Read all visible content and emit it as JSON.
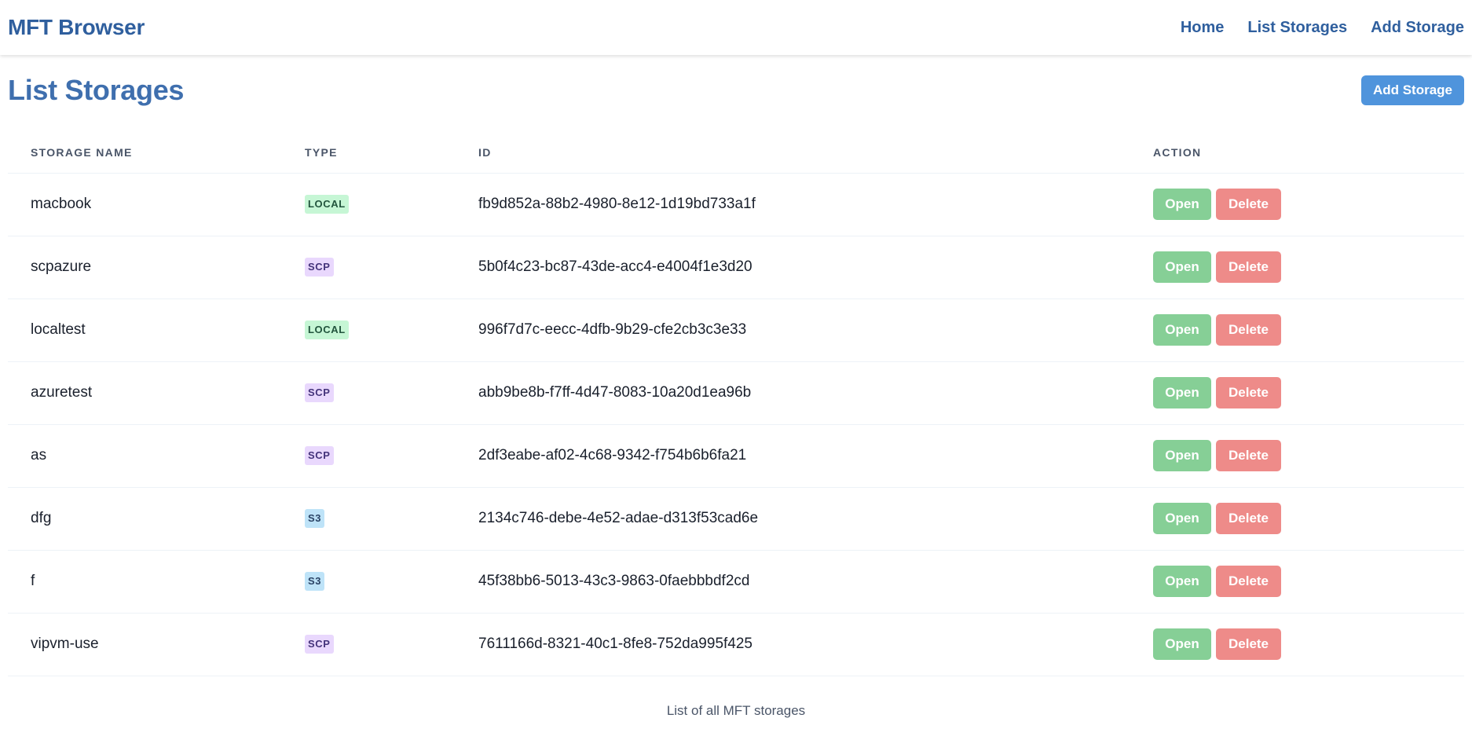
{
  "nav": {
    "brand": "MFT Browser",
    "links": [
      "Home",
      "List Storages",
      "Add Storage"
    ]
  },
  "page": {
    "title": "List Storages",
    "add_button": "Add Storage"
  },
  "table": {
    "headers": [
      "STORAGE NAME",
      "TYPE",
      "ID",
      "ACTION"
    ],
    "open_label": "Open",
    "delete_label": "Delete",
    "rows": [
      {
        "name": "macbook",
        "type": "LOCAL",
        "id": "fb9d852a-88b2-4980-8e12-1d19bd733a1f"
      },
      {
        "name": "scpazure",
        "type": "SCP",
        "id": "5b0f4c23-bc87-43de-acc4-e4004f1e3d20"
      },
      {
        "name": "localtest",
        "type": "LOCAL",
        "id": "996f7d7c-eecc-4dfb-9b29-cfe2cb3c3e33"
      },
      {
        "name": "azuretest",
        "type": "SCP",
        "id": "abb9be8b-f7ff-4d47-8083-10a20d1ea96b"
      },
      {
        "name": "as",
        "type": "SCP",
        "id": "2df3eabe-af02-4c68-9342-f754b6b6fa21"
      },
      {
        "name": "dfg",
        "type": "S3",
        "id": "2134c746-debe-4e52-adae-d313f53cad6e"
      },
      {
        "name": "f",
        "type": "S3",
        "id": "45f38bb6-5013-43c3-9863-0faebbbdf2cd"
      },
      {
        "name": "vipvm-use",
        "type": "SCP",
        "id": "7611166d-8321-40c1-8fe8-752da995f425"
      }
    ],
    "caption": "List of all MFT storages"
  },
  "colors": {
    "brand": "#2f5f9e",
    "primary_button": "#4f94dc",
    "open_button": "#86cf96",
    "delete_button": "#ee8b89",
    "badge_local": "#c6f6d5",
    "badge_scp": "#e9d8fd",
    "badge_s3": "#bee3f8"
  }
}
